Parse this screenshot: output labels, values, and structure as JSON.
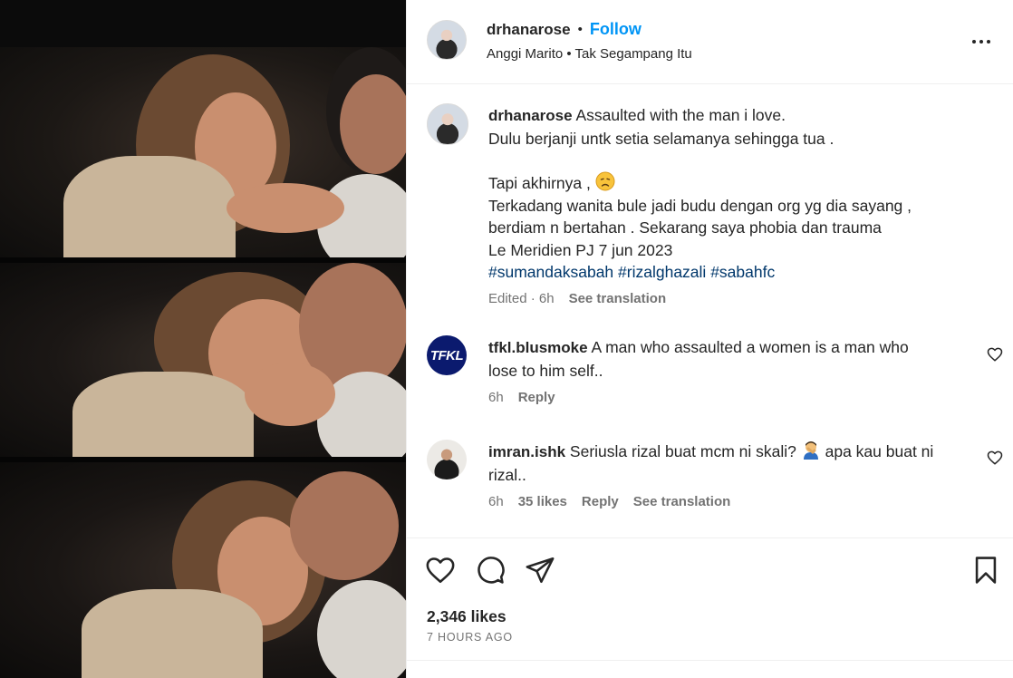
{
  "post": {
    "username": "drhanarose",
    "dot": "•",
    "follow_label": "Follow",
    "audio": "Anggi Marito • Tak Segampang Itu",
    "more_icon": "more-horizontal-icon"
  },
  "caption": {
    "username": "drhanarose",
    "line1": "Assaulted with the man i love.",
    "line2": "Dulu berjanji untk setia selamanya sehingga tua .",
    "line3_text": "Tapi akhirnya ,",
    "line3_emoji": "disappointed-face",
    "line4": "Terkadang wanita bule jadi budu dengan org yg dia sayang ,",
    "line5": "berdiam n bertahan . Sekarang saya phobia dan trauma",
    "line6": "Le Meridien PJ 7 jun 2023",
    "hashtags": [
      "#sumandaksabah",
      "#rizalghazali",
      "#sabahfc"
    ],
    "edited": "Edited",
    "time": "6h",
    "translate": "See translation"
  },
  "comments": [
    {
      "username": "tfkl.blusmoke",
      "avatar_text": "TFKL",
      "text_line1": "A man who assaulted a women is a man who",
      "text_line2": "lose to him self..",
      "time": "6h",
      "reply": "Reply"
    },
    {
      "username": "imran.ishk",
      "text_before": "Seriusla rizal buat mcm ni skali?",
      "emoji": "person-facepalming",
      "text_after": "apa kau buat ni",
      "text_line2": "rizal..",
      "time": "6h",
      "likes": "35 likes",
      "reply": "Reply",
      "translate": "See translation"
    }
  ],
  "actions": {
    "likes": "2,346 likes",
    "posted": "7 HOURS AGO",
    "icons": [
      "heart-icon",
      "comment-icon",
      "share-icon",
      "bookmark-icon"
    ]
  }
}
